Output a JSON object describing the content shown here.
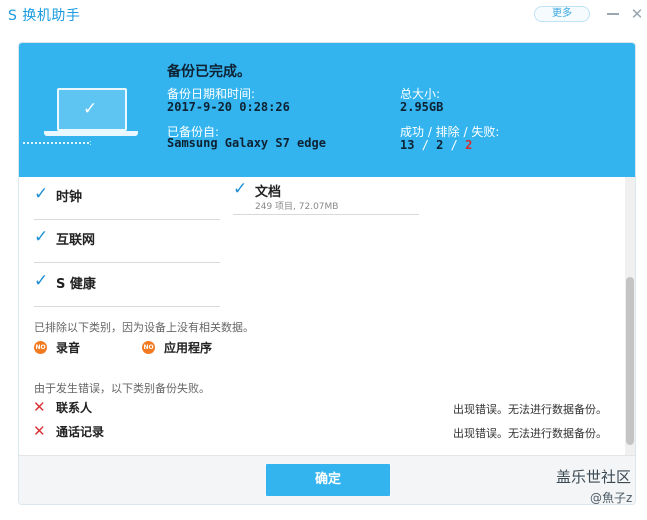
{
  "window": {
    "title": "S 换机助手",
    "more_label": "更多",
    "close_glyph": "✕"
  },
  "banner": {
    "title": "备份已完成。",
    "date_label": "备份日期和时间:",
    "date_value": "2017-9-20 0:28:26",
    "source_label": "已备份自:",
    "source_value": "Samsung Galaxy S7 edge",
    "size_label": "总大小:",
    "size_value": "2.95GB",
    "stats_label": "成功 / 排除 / 失败:",
    "stats": {
      "success": "13",
      "excluded": "2",
      "failed": "2",
      "separator": "/"
    }
  },
  "backed_up": [
    {
      "name": "时钟",
      "sub": ""
    },
    {
      "name": "文档",
      "sub": "249 项目, 72.07MB"
    },
    {
      "name": "互联网",
      "sub": ""
    },
    {
      "name": "S 健康",
      "sub": ""
    }
  ],
  "excluded": {
    "note": "已排除以下类别，因为设备上没有相关数据。",
    "badge": "NO",
    "items": [
      "录音",
      "应用程序"
    ]
  },
  "failed": {
    "note": "由于发生错误，以下类别备份失败。",
    "items": [
      {
        "name": "联系人",
        "message": "出现错误。无法进行数据备份。"
      },
      {
        "name": "通话记录",
        "message": "出现错误。无法进行数据备份。"
      }
    ]
  },
  "footer": {
    "confirm_label": "确定"
  },
  "watermark": {
    "line1": "盖乐世社区",
    "line2": "@魚子z"
  },
  "icons": {
    "check": "checkmark-icon",
    "laptop": "laptop-icon",
    "fail": "cross-icon",
    "excluded": "no-badge-icon"
  },
  "colors": {
    "accent": "#33b4ee",
    "check": "#1f8fd6",
    "fail": "#d62d2d",
    "excluded_badge": "#f27a21"
  }
}
